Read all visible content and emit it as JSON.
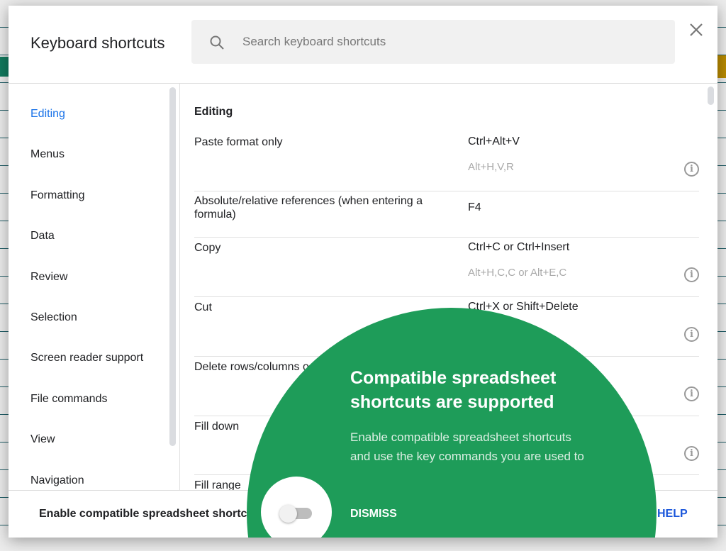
{
  "dialog": {
    "title": "Keyboard shortcuts",
    "search_placeholder": "Search keyboard shortcuts"
  },
  "nav": {
    "items": [
      "Editing",
      "Menus",
      "Formatting",
      "Data",
      "Review",
      "Selection",
      "Screen reader support",
      "File commands",
      "View",
      "Navigation"
    ],
    "active": "Editing"
  },
  "content": {
    "section": "Editing",
    "rows": [
      {
        "label": "Paste format only",
        "key": "Ctrl+Alt+V",
        "alt": "Alt+H,V,R"
      },
      {
        "label": "Absolute/relative references (when entering a formula)",
        "key": "F4",
        "alt": ""
      },
      {
        "label": "Copy",
        "key": "Ctrl+C or Ctrl+Insert",
        "alt": "Alt+H,C,C or Alt+E,C"
      },
      {
        "label": "Cut",
        "key": "Ctrl+X or Shift+Delete",
        "alt": ""
      },
      {
        "label": "Delete rows/columns o",
        "key": "",
        "alt": ""
      },
      {
        "label": "Fill down",
        "key": "",
        "alt": ""
      },
      {
        "label": "Fill range",
        "key": "",
        "alt": ""
      }
    ]
  },
  "footer": {
    "label": "Enable compatible spreadsheet shortcuts",
    "toggle_on": false,
    "help": "HELP"
  },
  "promo": {
    "title": "Compatible spreadsheet shortcuts are supported",
    "body": "Enable compatible spreadsheet shortcuts and use the key commands you are used to",
    "dismiss": "DISMISS",
    "color": "#1e9c59"
  }
}
